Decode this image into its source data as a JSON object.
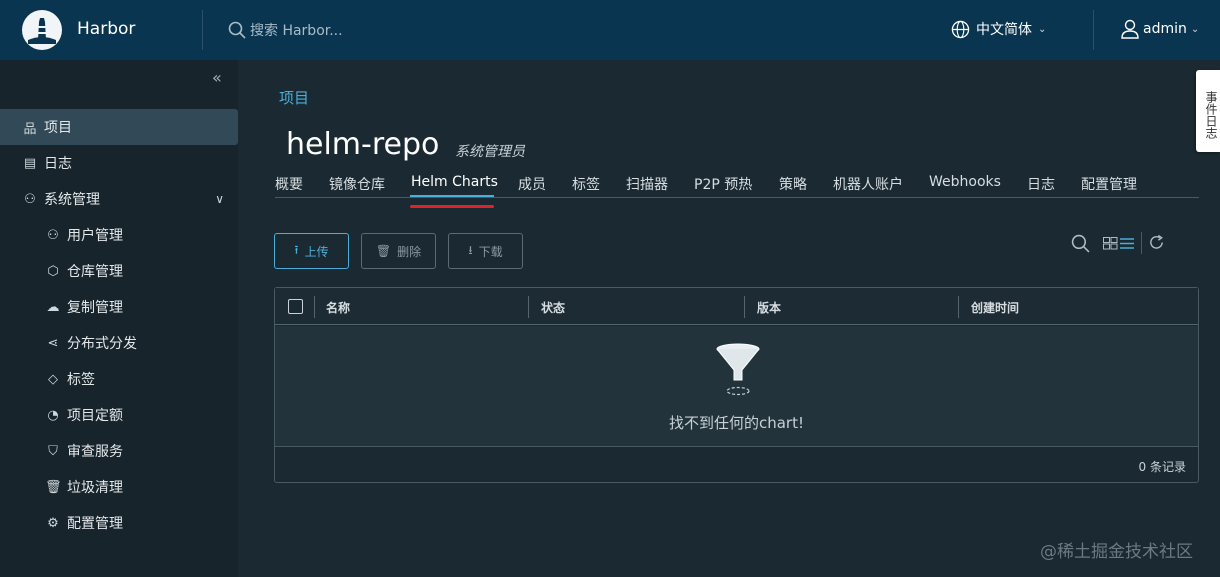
{
  "header": {
    "brand": "Harbor",
    "search_placeholder": "搜索 Harbor...",
    "language": "中文简体",
    "user": "admin"
  },
  "sidebar": {
    "items": [
      {
        "label": "项目",
        "icon": "projects-icon",
        "active": true
      },
      {
        "label": "日志",
        "icon": "logs-icon"
      },
      {
        "label": "系统管理",
        "icon": "admin-icon",
        "expandable": true
      },
      {
        "label": "用户管理",
        "icon": "users-icon",
        "sub": true
      },
      {
        "label": "仓库管理",
        "icon": "registry-icon",
        "sub": true
      },
      {
        "label": "复制管理",
        "icon": "replication-icon",
        "sub": true
      },
      {
        "label": "分布式分发",
        "icon": "distribution-icon",
        "sub": true
      },
      {
        "label": "标签",
        "icon": "tag-icon",
        "sub": true
      },
      {
        "label": "项目定额",
        "icon": "quota-icon",
        "sub": true
      },
      {
        "label": "审查服务",
        "icon": "shield-icon",
        "sub": true
      },
      {
        "label": "垃圾清理",
        "icon": "trash-icon",
        "sub": true
      },
      {
        "label": "配置管理",
        "icon": "gear-icon",
        "sub": true
      }
    ]
  },
  "breadcrumb": "项目",
  "project": {
    "name": "helm-repo",
    "role": "系统管理员"
  },
  "tabs": [
    "概要",
    "镜像仓库",
    "Helm Charts",
    "成员",
    "标签",
    "扫描器",
    "P2P 预热",
    "策略",
    "机器人账户",
    "Webhooks",
    "日志",
    "配置管理"
  ],
  "active_tab": "Helm Charts",
  "toolbar": {
    "upload": "上传",
    "delete": "删除",
    "download": "下载"
  },
  "grid": {
    "columns": [
      "名称",
      "状态",
      "版本",
      "创建时间"
    ],
    "empty_message": "找不到任何的chart!",
    "footer": "0 条记录"
  },
  "event_log_tab": "事件日志",
  "watermark": "@稀土掘金技术社区",
  "colors": {
    "header": "#0a3550",
    "accent": "#4aaed9",
    "background": "#1b2a32",
    "sidebar": "#17242b"
  }
}
